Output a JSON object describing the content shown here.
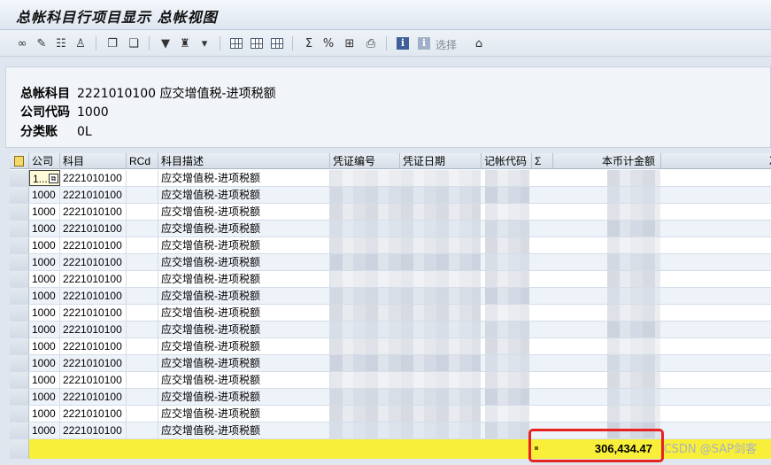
{
  "window": {
    "title": "总帐科目行项目显示 总帐视图"
  },
  "toolbar": {
    "items": [
      {
        "name": "glasses-icon",
        "glyph": "∞"
      },
      {
        "name": "pencil-icon",
        "glyph": "✎"
      },
      {
        "name": "grid-details-icon",
        "glyph": "☷"
      },
      {
        "name": "stamp-icon",
        "glyph": "♙"
      },
      {
        "name": "doc-prev-icon",
        "glyph": "❐"
      },
      {
        "name": "doc-next-icon",
        "glyph": "❏"
      },
      {
        "name": "filter-icon",
        "glyph": "▼"
      },
      {
        "name": "sort-asc-icon",
        "glyph": "♜"
      },
      {
        "name": "sort-desc-icon",
        "glyph": "▾"
      },
      {
        "name": "layout-icon",
        "glyph": "▦"
      },
      {
        "name": "layout-change-icon",
        "glyph": "▤"
      },
      {
        "name": "layout-save-icon",
        "glyph": "▥"
      },
      {
        "name": "sum-icon",
        "glyph": "Σ"
      },
      {
        "name": "subtotal-icon",
        "glyph": "%"
      },
      {
        "name": "export-icon",
        "glyph": "⊞"
      },
      {
        "name": "print-icon",
        "glyph": "⎙"
      },
      {
        "name": "info-icon",
        "glyph": "i"
      },
      {
        "name": "select-info-icon",
        "glyph": "i"
      },
      {
        "name": "stamp2-icon",
        "glyph": "⌂"
      }
    ],
    "select_label": "选择"
  },
  "header": {
    "account_label": "总帐科目",
    "account_value": "2221010100 应交增值税-进项税额",
    "company_label": "公司代码",
    "company_value": "1000",
    "ledger_label": "分类账",
    "ledger_value": "0L"
  },
  "table": {
    "columns": [
      "公司",
      "科目",
      "RCd",
      "科目描述",
      "凭证编号",
      "凭证日期",
      "记帐代码",
      "Σ",
      "本币计金额",
      "冲销关于"
    ],
    "first_row_company": "1...",
    "rows": [
      {
        "company": "1000",
        "account": "2221010100",
        "rcd": "",
        "desc": "应交增值税-进项税额"
      },
      {
        "company": "1000",
        "account": "2221010100",
        "rcd": "",
        "desc": "应交增值税-进项税额"
      },
      {
        "company": "1000",
        "account": "2221010100",
        "rcd": "",
        "desc": "应交增值税-进项税额"
      },
      {
        "company": "1000",
        "account": "2221010100",
        "rcd": "",
        "desc": "应交增值税-进项税额"
      },
      {
        "company": "1000",
        "account": "2221010100",
        "rcd": "",
        "desc": "应交增值税-进项税额"
      },
      {
        "company": "1000",
        "account": "2221010100",
        "rcd": "",
        "desc": "应交增值税-进项税额"
      },
      {
        "company": "1000",
        "account": "2221010100",
        "rcd": "",
        "desc": "应交增值税-进项税额"
      },
      {
        "company": "1000",
        "account": "2221010100",
        "rcd": "",
        "desc": "应交增值税-进项税额"
      },
      {
        "company": "1000",
        "account": "2221010100",
        "rcd": "",
        "desc": "应交增值税-进项税额"
      },
      {
        "company": "1000",
        "account": "2221010100",
        "rcd": "",
        "desc": "应交增值税-进项税额"
      },
      {
        "company": "1000",
        "account": "2221010100",
        "rcd": "",
        "desc": "应交增值税-进项税额"
      },
      {
        "company": "1000",
        "account": "2221010100",
        "rcd": "",
        "desc": "应交增值税-进项税额"
      },
      {
        "company": "1000",
        "account": "2221010100",
        "rcd": "",
        "desc": "应交增值税-进项税额"
      },
      {
        "company": "1000",
        "account": "2221010100",
        "rcd": "",
        "desc": "应交增值税-进项税额"
      },
      {
        "company": "1000",
        "account": "2221010100",
        "rcd": "",
        "desc": "应交增值税-进项税额"
      },
      {
        "company": "1000",
        "account": "2221010100",
        "rcd": "",
        "desc": "应交增值税-进项税额"
      }
    ],
    "total": "306,434.47",
    "total_bar_color": "#f8ef3a",
    "highlight_color": "#e8231f"
  },
  "watermark": "CSDN @SAP剑客"
}
